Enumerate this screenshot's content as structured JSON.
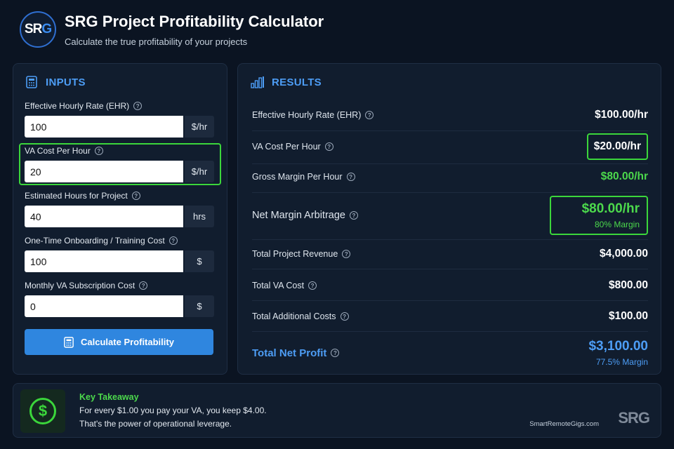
{
  "header": {
    "logo_part1": "SR",
    "logo_part2": "G",
    "title": "SRG Project Profitability Calculator",
    "subtitle": "Calculate the true profitability of your projects"
  },
  "inputs": {
    "title": "INPUTS",
    "fields": [
      {
        "label": "Effective Hourly Rate (EHR)",
        "value": "100",
        "unit": "$/hr"
      },
      {
        "label": "VA Cost Per Hour",
        "value": "20",
        "unit": "$/hr"
      },
      {
        "label": "Estimated Hours for Project",
        "value": "40",
        "unit": "hrs"
      },
      {
        "label": "One-Time Onboarding / Training Cost",
        "value": "100",
        "unit": "$"
      },
      {
        "label": "Monthly VA Subscription Cost",
        "value": "0",
        "unit": "$"
      }
    ],
    "calculate_label": "Calculate Profitability"
  },
  "results": {
    "title": "RESULTS",
    "rows": [
      {
        "label": "Effective Hourly Rate (EHR)",
        "value": "$100.00/hr"
      },
      {
        "label": "VA Cost Per Hour",
        "value": "$20.00/hr"
      },
      {
        "label": "Gross Margin Per Hour",
        "value": "$80.00/hr"
      },
      {
        "label": "Net Margin Arbitrage",
        "value": "$80.00/hr",
        "sub": "80% Margin"
      },
      {
        "label": "Total Project Revenue",
        "value": "$4,000.00"
      },
      {
        "label": "Total VA Cost",
        "value": "$800.00"
      },
      {
        "label": "Total Additional Costs",
        "value": "$100.00"
      },
      {
        "label": "Total Net Profit",
        "value": "$3,100.00",
        "sub": "77.5% Margin"
      }
    ]
  },
  "takeaway": {
    "title": "Key Takeaway",
    "line1": "For every $1.00 you pay your VA, you keep $4.00.",
    "line2": "That's the power of operational leverage.",
    "site": "SmartRemoteGigs.com",
    "logo": "SRG"
  },
  "colors": {
    "background": "#0b1422",
    "accent_blue": "#4d9df5",
    "accent_green": "#4cd94c",
    "button": "#2f86df"
  }
}
